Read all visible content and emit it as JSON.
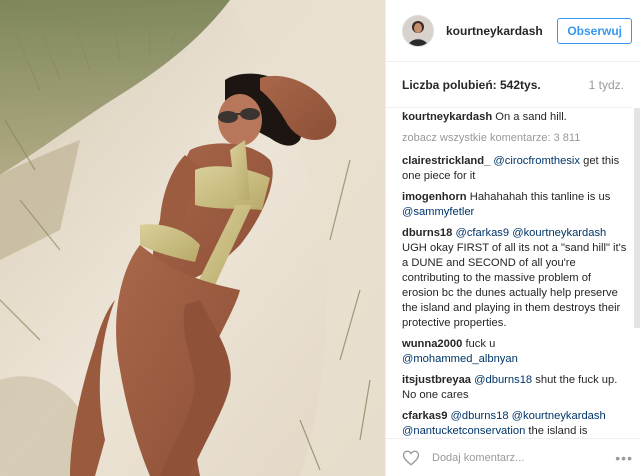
{
  "post": {
    "username": "kourtneykardash",
    "follow_label": "Obserwuj",
    "likes_text": "Liczba polubień: 542tys.",
    "time_ago": "1 tydz.",
    "caption_user": "kourtneykardash",
    "caption_text": "On a sand hill.",
    "view_all": "zobacz wszystkie komentarze: 3 811",
    "add_comment_placeholder": "Dodaj komentarz...",
    "more_icon": "•••"
  },
  "comments": [
    {
      "user": "clairestrickland_",
      "mention": "@cirocfromthesix",
      "text": " get this one piece for it"
    },
    {
      "user": "imogenhorn",
      "mention": "",
      "text": "Hahahahah this tanline is us",
      "mention2": "@sammyfetler"
    },
    {
      "user": "dburns18",
      "mention": "@cfarkas9 @kourtneykardash",
      "text": " UGH okay FIRST of all its not a \"sand hill\" it's a DUNE and SECOND of all you're contributing to the massive problem of erosion bc the dunes actually help preserve the island and playing in them destroys their protective properties."
    },
    {
      "user": "wunna2000",
      "mention": "",
      "text": "fuck u",
      "mention2": "@mohammed_albnyan"
    },
    {
      "user": "itsjustbreyaa",
      "mention": "@dburns18",
      "text": " shut the fuck up. No one cares"
    },
    {
      "user": "cfarkas9",
      "mention": "@dburns18 @kourtneykardash @nantucketconservation",
      "text": " the island is"
    }
  ],
  "colors": {
    "link": "#003569",
    "follow": "#3897f0",
    "muted": "#999999"
  },
  "icons": [
    "heart-icon",
    "more-options-icon"
  ]
}
